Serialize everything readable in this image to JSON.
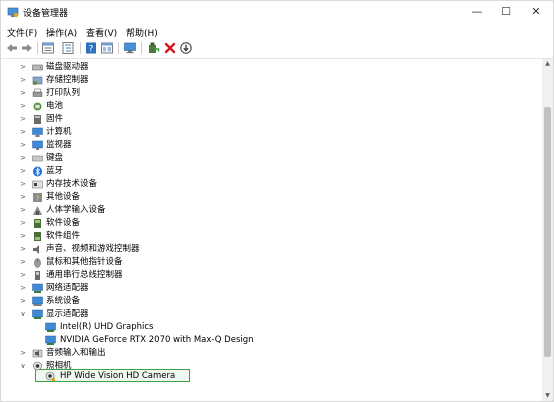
{
  "window": {
    "title": "设备管理器",
    "icon": "device-manager-icon"
  },
  "titlebar": {
    "minimize": "—",
    "maximize": "☐",
    "close": "✕"
  },
  "menu": [
    "文件(F)",
    "操作(A)",
    "查看(V)",
    "帮助(H)"
  ],
  "toolbar": {
    "buttons": [
      "back-arrow-icon",
      "forward-arrow-icon",
      "properties-icon",
      "tree-view-icon",
      "help-icon",
      "view-list-icon",
      "monitor-icon",
      "update-driver-icon",
      "uninstall-icon",
      "scan-hardware-icon"
    ]
  },
  "tree": {
    "items": [
      {
        "label": "磁盘驱动器",
        "icon": "disk-drive-icon",
        "expanded": false
      },
      {
        "label": "存储控制器",
        "icon": "storage-controller-icon",
        "expanded": false
      },
      {
        "label": "打印队列",
        "icon": "print-queue-icon",
        "expanded": false
      },
      {
        "label": "电池",
        "icon": "battery-icon",
        "expanded": false
      },
      {
        "label": "固件",
        "icon": "firmware-icon",
        "expanded": false
      },
      {
        "label": "计算机",
        "icon": "computer-icon",
        "expanded": false
      },
      {
        "label": "监视器",
        "icon": "monitor-icon",
        "expanded": false
      },
      {
        "label": "键盘",
        "icon": "keyboard-icon",
        "expanded": false
      },
      {
        "label": "蓝牙",
        "icon": "bluetooth-icon",
        "expanded": false
      },
      {
        "label": "内存技术设备",
        "icon": "memory-device-icon",
        "expanded": false
      },
      {
        "label": "其他设备",
        "icon": "other-devices-icon",
        "expanded": false
      },
      {
        "label": "人体学输入设备",
        "icon": "hid-icon",
        "expanded": false
      },
      {
        "label": "软件设备",
        "icon": "software-device-icon",
        "expanded": false
      },
      {
        "label": "软件组件",
        "icon": "software-component-icon",
        "expanded": false
      },
      {
        "label": "声音、视频和游戏控制器",
        "icon": "sound-icon",
        "expanded": false
      },
      {
        "label": "鼠标和其他指针设备",
        "icon": "mouse-icon",
        "expanded": false
      },
      {
        "label": "通用串行总线控制器",
        "icon": "usb-icon",
        "expanded": false
      },
      {
        "label": "网络适配器",
        "icon": "network-adapter-icon",
        "expanded": false
      },
      {
        "label": "系统设备",
        "icon": "system-device-icon",
        "expanded": false
      },
      {
        "label": "显示适配器",
        "icon": "display-adapter-icon",
        "expanded": true
      },
      {
        "label": "Intel(R) UHD Graphics",
        "icon": "display-adapter-icon",
        "child": true
      },
      {
        "label": "NVIDIA GeForce RTX 2070 with Max-Q Design",
        "icon": "display-adapter-icon",
        "child": true
      },
      {
        "label": "音频输入和输出",
        "icon": "audio-io-icon",
        "expanded": false
      },
      {
        "label": "照相机",
        "icon": "camera-icon",
        "expanded": true
      },
      {
        "label": "HP Wide Vision HD Camera",
        "icon": "webcam-icon",
        "child": true,
        "selected": true
      }
    ]
  },
  "scrollbar": {
    "up": "▲",
    "down": "▼"
  }
}
